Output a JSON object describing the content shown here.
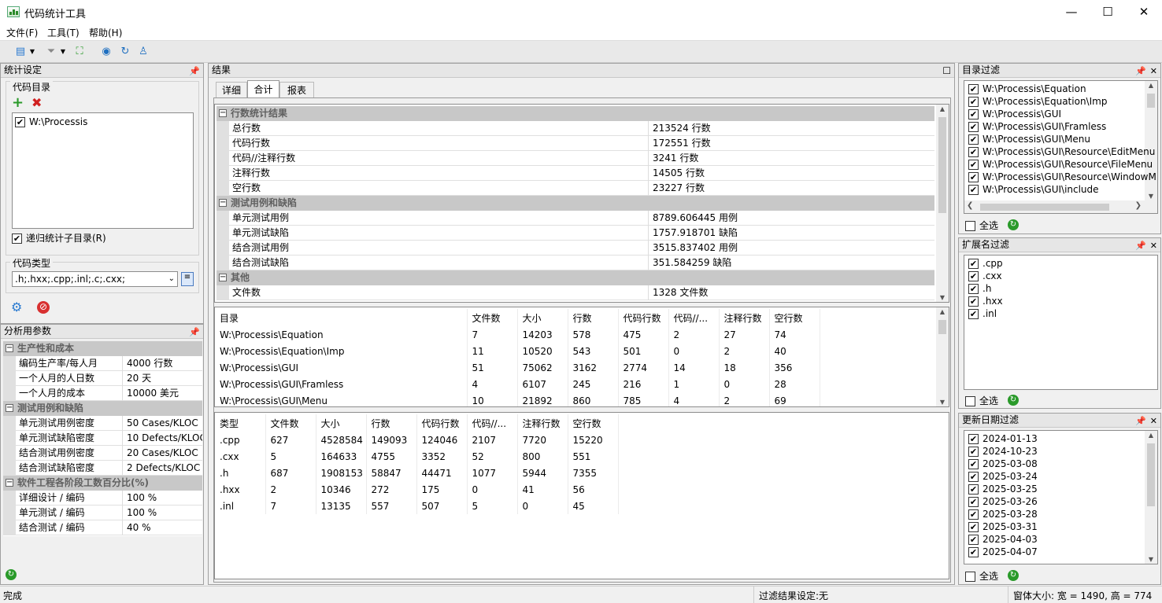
{
  "window": {
    "title": "代码统计工具",
    "min": "—",
    "max": "☐",
    "close": "✕"
  },
  "menu": [
    "文件(F)",
    "工具(T)",
    "帮助(H)"
  ],
  "left": {
    "title": "统计设定",
    "code_dir_label": "代码目录",
    "dirs": [
      "W:\\Processis"
    ],
    "recursive_label": "递归统计子目录(R)",
    "code_type_label": "代码类型",
    "code_type_value": ".h;.hxx;.cpp;.inl;.c;.cxx;",
    "params_title": "分析用参数",
    "sections": [
      {
        "name": "生产性和成本",
        "rows": [
          [
            "编码生产率/每人月",
            "4000 行数"
          ],
          [
            "一个人月的人日数",
            "20 天"
          ],
          [
            "一个人月的成本",
            "10000 美元"
          ]
        ]
      },
      {
        "name": "测试用例和缺陷",
        "rows": [
          [
            "单元测试用例密度",
            "50 Cases/KLOC"
          ],
          [
            "单元测试缺陷密度",
            "10 Defects/KLOC"
          ],
          [
            "结合测试用例密度",
            "20 Cases/KLOC"
          ],
          [
            "结合测试缺陷密度",
            "2 Defects/KLOC"
          ]
        ]
      },
      {
        "name": "软件工程各阶段工数百分比(%)",
        "rows": [
          [
            "详细设计 / 编码",
            "100 %"
          ],
          [
            "单元测试 / 编码",
            "100 %"
          ],
          [
            "结合测试 / 编码",
            "40 %"
          ]
        ]
      }
    ]
  },
  "center": {
    "title": "结果",
    "tabs": [
      "详细",
      "合计",
      "报表"
    ],
    "summary": [
      {
        "name": "行数统计结果",
        "rows": [
          [
            "总行数",
            "213524 行数"
          ],
          [
            "代码行数",
            "172551 行数"
          ],
          [
            "代码//注释行数",
            "3241 行数"
          ],
          [
            "注释行数",
            "14505 行数"
          ],
          [
            "空行数",
            "23227 行数"
          ]
        ]
      },
      {
        "name": "测试用例和缺陷",
        "rows": [
          [
            "单元测试用例",
            "8789.606445 用例"
          ],
          [
            "单元测试缺陷",
            "1757.918701 缺陷"
          ],
          [
            "结合测试用例",
            "3515.837402 用例"
          ],
          [
            "结合测试缺陷",
            "351.584259 缺陷"
          ]
        ]
      },
      {
        "name": "其他",
        "rows": [
          [
            "文件数",
            "1328 文件数"
          ]
        ]
      }
    ],
    "dir_table": {
      "headers": [
        "目录",
        "文件数",
        "大小",
        "行数",
        "代码行数",
        "代码//...",
        "注释行数",
        "空行数"
      ],
      "rows": [
        [
          "W:\\Processis\\Equation",
          "7",
          "14203",
          "578",
          "475",
          "2",
          "27",
          "74"
        ],
        [
          "W:\\Processis\\Equation\\Imp",
          "11",
          "10520",
          "543",
          "501",
          "0",
          "2",
          "40"
        ],
        [
          "W:\\Processis\\GUI",
          "51",
          "75062",
          "3162",
          "2774",
          "14",
          "18",
          "356"
        ],
        [
          "W:\\Processis\\GUI\\Framless",
          "4",
          "6107",
          "245",
          "216",
          "1",
          "0",
          "28"
        ],
        [
          "W:\\Processis\\GUI\\Menu",
          "10",
          "21892",
          "860",
          "785",
          "4",
          "2",
          "69"
        ]
      ]
    },
    "type_table": {
      "headers": [
        "类型",
        "文件数",
        "大小",
        "行数",
        "代码行数",
        "代码//...",
        "注释行数",
        "空行数"
      ],
      "rows": [
        [
          ".cpp",
          "627",
          "4528584",
          "149093",
          "124046",
          "2107",
          "7720",
          "15220"
        ],
        [
          ".cxx",
          "5",
          "164633",
          "4755",
          "3352",
          "52",
          "800",
          "551"
        ],
        [
          ".h",
          "687",
          "1908153",
          "58847",
          "44471",
          "1077",
          "5944",
          "7355"
        ],
        [
          ".hxx",
          "2",
          "10346",
          "272",
          "175",
          "0",
          "41",
          "56"
        ],
        [
          ".inl",
          "7",
          "13135",
          "557",
          "507",
          "5",
          "0",
          "45"
        ]
      ]
    }
  },
  "right": {
    "dir_filter_title": "目录过滤",
    "dir_filter": [
      "W:\\Processis\\Equation",
      "W:\\Processis\\Equation\\Imp",
      "W:\\Processis\\GUI",
      "W:\\Processis\\GUI\\Framless",
      "W:\\Processis\\GUI\\Menu",
      "W:\\Processis\\GUI\\Resource\\EditMenu",
      "W:\\Processis\\GUI\\Resource\\FileMenu",
      "W:\\Processis\\GUI\\Resource\\WindowM",
      "W:\\Processis\\GUI\\include"
    ],
    "ext_filter_title": "扩展名过滤",
    "ext_filter": [
      ".cpp",
      ".cxx",
      ".h",
      ".hxx",
      ".inl"
    ],
    "date_filter_title": "更新日期过滤",
    "date_filter": [
      "2024-01-13",
      "2024-10-23",
      "2025-03-08",
      "2025-03-24",
      "2025-03-25",
      "2025-03-26",
      "2025-03-28",
      "2025-03-31",
      "2025-04-03",
      "2025-04-07"
    ],
    "select_all": "全选"
  },
  "status": {
    "left": "完成",
    "mid": "过滤结果设定:无",
    "right": "窗体大小: 宽 = 1490, 高 = 774"
  }
}
